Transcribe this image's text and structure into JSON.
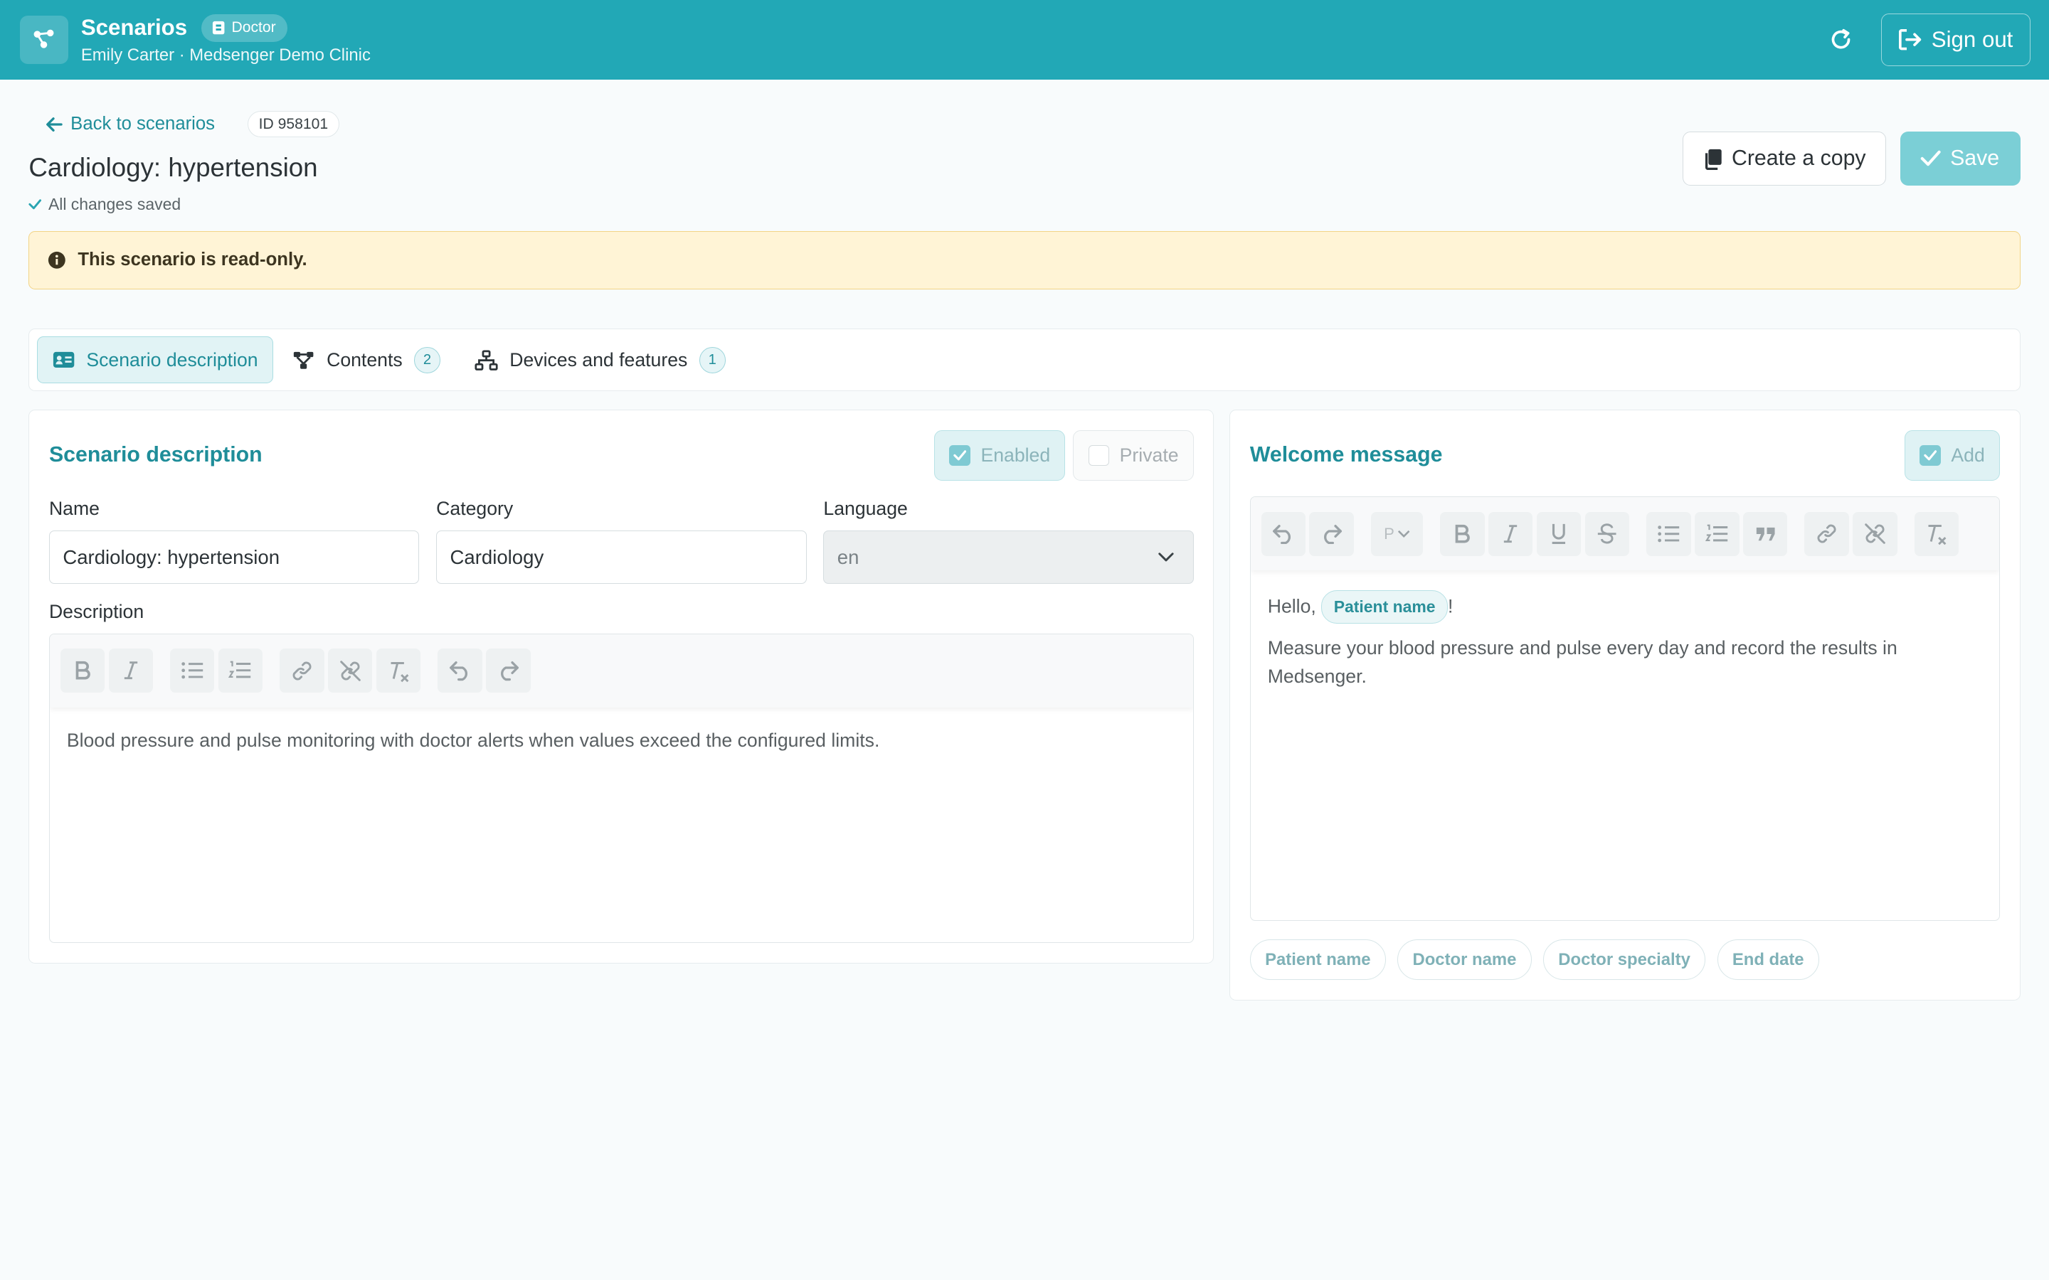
{
  "header": {
    "title": "Scenarios",
    "role_badge": "Doctor",
    "subtitle": "Emily Carter · Medsenger Demo Clinic",
    "sign_out_label": "Sign out"
  },
  "nav": {
    "back_label": "Back to scenarios",
    "id_badge": "ID 958101"
  },
  "page": {
    "title": "Cardiology: hypertension",
    "saved_status": "All changes saved"
  },
  "actions": {
    "copy_label": "Create a copy",
    "save_label": "Save"
  },
  "alert": {
    "text": "This scenario is read-only."
  },
  "tabs": [
    {
      "label": "Scenario description",
      "active": true
    },
    {
      "label": "Contents",
      "count": "2"
    },
    {
      "label": "Devices and features",
      "count": "1"
    }
  ],
  "description_panel": {
    "title": "Scenario description",
    "enabled_label": "Enabled",
    "enabled_checked": true,
    "private_label": "Private",
    "private_checked": false,
    "name_label": "Name",
    "name_value": "Cardiology: hypertension",
    "category_label": "Category",
    "category_value": "Cardiology",
    "language_label": "Language",
    "language_value": "en",
    "description_label": "Description",
    "description_text": "Blood pressure and pulse monitoring with doctor alerts when values exceed the configured limits."
  },
  "welcome_panel": {
    "title": "Welcome message",
    "add_label": "Add",
    "add_checked": true,
    "heading_select": "P",
    "greeting": "Hello,",
    "greeting_placeholder": "Patient name",
    "greeting_end": "!",
    "body": "Measure your blood pressure and pulse every day and record the results in Medsenger.",
    "chips": [
      "Patient name",
      "Doctor name",
      "Doctor specialty",
      "End date"
    ]
  },
  "colors": {
    "accent": "#22a8b6",
    "accent_text": "#1f8d99",
    "alert_bg": "#fff4d6",
    "save_bg": "#7bcfd6"
  }
}
